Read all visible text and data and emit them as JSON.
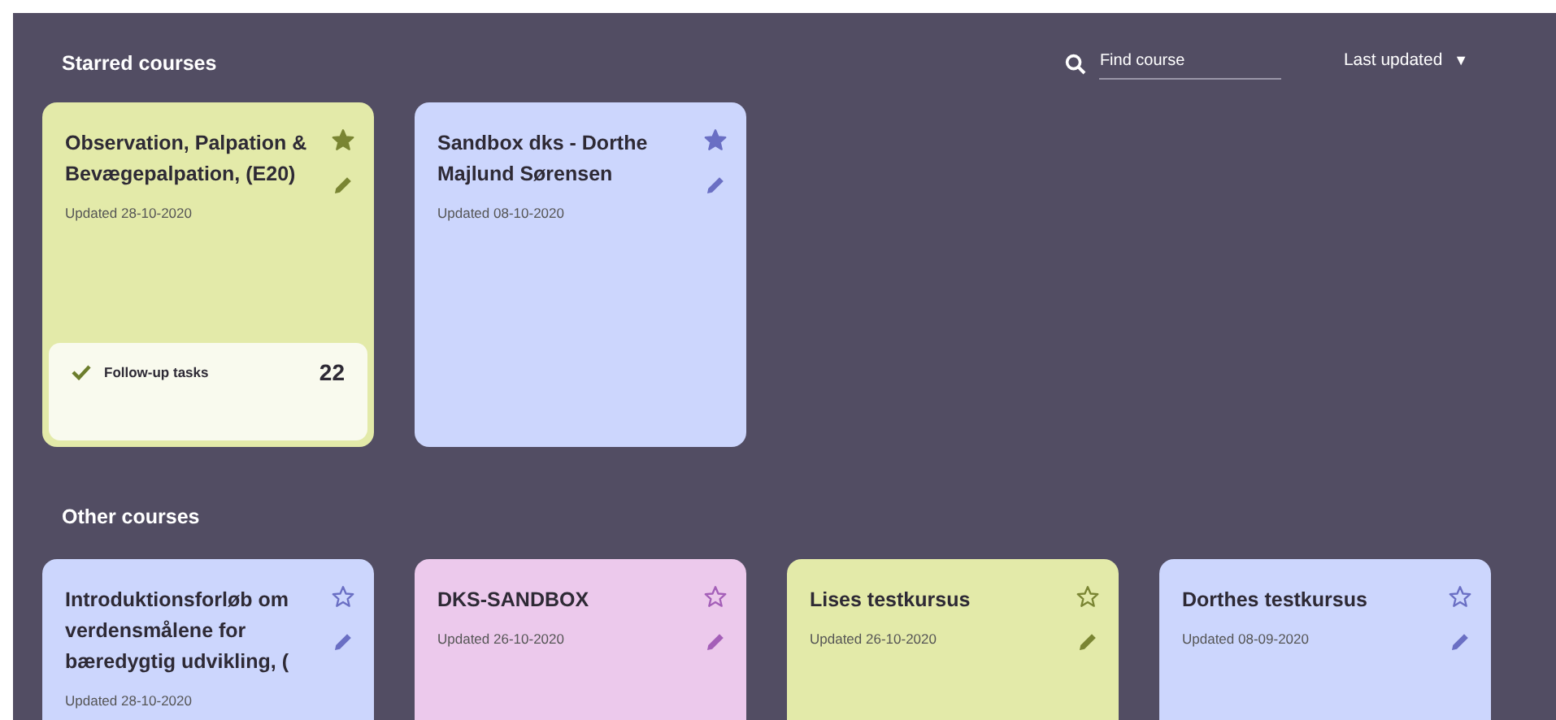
{
  "starred_heading": "Starred courses",
  "search": {
    "placeholder": "Find course"
  },
  "sort": {
    "label": "Last updated",
    "arrow": "▼"
  },
  "starred_courses": [
    {
      "title": "Observation, Palpation & Bevægepalpation, (E20)",
      "updated": "Updated 28-10-2020",
      "color": "#e3eaa9",
      "starred": true,
      "tasks": {
        "label": "Follow-up tasks",
        "count": "22"
      }
    },
    {
      "title": "Sandbox dks - Dorthe Majlund Sørensen",
      "updated": "Updated 08-10-2020",
      "color": "#ccd6fd",
      "starred": true
    }
  ],
  "other_heading": "Other courses",
  "other_courses": [
    {
      "title": "Introduktionsforløb om verdensmålene for bæredygtig udvikling, (",
      "updated": "Updated 28-10-2020",
      "color": "#ccd6fd",
      "starred": false
    },
    {
      "title": "DKS-SANDBOX",
      "updated": "Updated 26-10-2020",
      "color": "#ecc9ec",
      "starred": false
    },
    {
      "title": "Lises testkursus",
      "updated": "Updated 26-10-2020",
      "color": "#e3eaa9",
      "starred": false
    },
    {
      "title": "Dorthes testkursus",
      "updated": "Updated 08-09-2020",
      "color": "#ccd6fd",
      "starred": false
    }
  ]
}
